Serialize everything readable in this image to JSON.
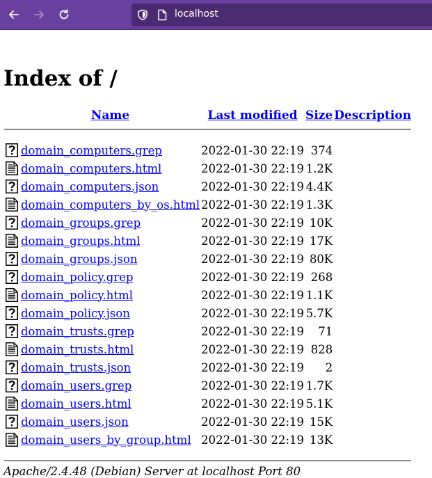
{
  "browser": {
    "url": "localhost"
  },
  "page": {
    "heading": "Index of /",
    "columns": {
      "name": "Name",
      "last_modified": "Last modified",
      "size": "Size",
      "description": "Description"
    },
    "files": [
      {
        "name": "domain_computers.grep",
        "modified": "2022-01-30 22:19",
        "size": "374",
        "icon": "unknown-file-icon"
      },
      {
        "name": "domain_computers.html",
        "modified": "2022-01-30 22:19",
        "size": "1.2K",
        "icon": "text-file-icon"
      },
      {
        "name": "domain_computers.json",
        "modified": "2022-01-30 22:19",
        "size": "4.4K",
        "icon": "unknown-file-icon"
      },
      {
        "name": "domain_computers_by_os.html",
        "modified": "2022-01-30 22:19",
        "size": "1.3K",
        "icon": "text-file-icon"
      },
      {
        "name": "domain_groups.grep",
        "modified": "2022-01-30 22:19",
        "size": "10K",
        "icon": "unknown-file-icon"
      },
      {
        "name": "domain_groups.html",
        "modified": "2022-01-30 22:19",
        "size": "17K",
        "icon": "text-file-icon"
      },
      {
        "name": "domain_groups.json",
        "modified": "2022-01-30 22:19",
        "size": "80K",
        "icon": "unknown-file-icon"
      },
      {
        "name": "domain_policy.grep",
        "modified": "2022-01-30 22:19",
        "size": "268",
        "icon": "unknown-file-icon"
      },
      {
        "name": "domain_policy.html",
        "modified": "2022-01-30 22:19",
        "size": "1.1K",
        "icon": "text-file-icon"
      },
      {
        "name": "domain_policy.json",
        "modified": "2022-01-30 22:19",
        "size": "5.7K",
        "icon": "unknown-file-icon"
      },
      {
        "name": "domain_trusts.grep",
        "modified": "2022-01-30 22:19",
        "size": "71",
        "icon": "unknown-file-icon"
      },
      {
        "name": "domain_trusts.html",
        "modified": "2022-01-30 22:19",
        "size": "828",
        "icon": "text-file-icon"
      },
      {
        "name": "domain_trusts.json",
        "modified": "2022-01-30 22:19",
        "size": "2",
        "icon": "unknown-file-icon"
      },
      {
        "name": "domain_users.grep",
        "modified": "2022-01-30 22:19",
        "size": "1.7K",
        "icon": "unknown-file-icon"
      },
      {
        "name": "domain_users.html",
        "modified": "2022-01-30 22:19",
        "size": "5.1K",
        "icon": "text-file-icon"
      },
      {
        "name": "domain_users.json",
        "modified": "2022-01-30 22:19",
        "size": "15K",
        "icon": "unknown-file-icon"
      },
      {
        "name": "domain_users_by_group.html",
        "modified": "2022-01-30 22:19",
        "size": "13K",
        "icon": "text-file-icon"
      }
    ],
    "footer": "Apache/2.4.48 (Debian) Server at localhost Port 80"
  },
  "colors": {
    "toolbar": "#6b3fa0",
    "urlbar": "#4c2a72",
    "link": "#0000ee"
  }
}
